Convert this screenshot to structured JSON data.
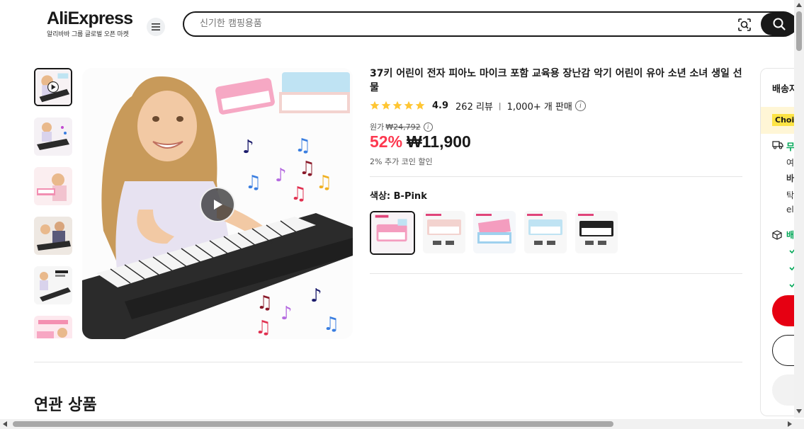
{
  "header": {
    "logo_text": "AliExpress",
    "logo_sub": "알리바바 그룹 글로벌 오픈 마켓",
    "search_placeholder": "신기한 캠핑용품"
  },
  "product": {
    "title": "37키 어린이 전자 피아노 마이크 포함 교육용 장난감 악기 어린이 유아 소년 소녀 생일 선물",
    "rating": "4.9",
    "review_count": "262 리뷰",
    "rating_separator": "|",
    "sold": "1,000+ 개 판매",
    "stars": 5,
    "original_price_label": "원가",
    "original_price": "₩24,792",
    "discount": "52%",
    "price": "₩11,900",
    "coin_text": "2% 추가 코인 할인",
    "color_label": "색상: B-Pink",
    "info_glyph": "i"
  },
  "swatches": [
    {
      "name": "B-Pink",
      "selected": true
    },
    {
      "name": "Pink-2",
      "selected": false
    },
    {
      "name": "Blue-Mic",
      "selected": false
    },
    {
      "name": "Blue",
      "selected": false
    },
    {
      "name": "Black",
      "selected": false
    }
  ],
  "thumbnails": [
    {
      "label": "video",
      "active": true
    },
    {
      "label": "image-2",
      "active": false
    },
    {
      "label": "image-3",
      "active": false
    },
    {
      "label": "image-4",
      "active": false
    },
    {
      "label": "image-5",
      "active": false
    },
    {
      "label": "image-6",
      "active": false
    }
  ],
  "right_panel": {
    "title": "배송지",
    "choice_badge": "Choi",
    "free": "무",
    "line1": "여",
    "line2": "바",
    "line3": "탁",
    "line4": "el",
    "line5": "배"
  },
  "related": {
    "title": "연관 상품"
  },
  "colors": {
    "accent_red": "#fd384f",
    "button_red": "#e60012",
    "star": "#ffc633",
    "dark": "#191919"
  }
}
